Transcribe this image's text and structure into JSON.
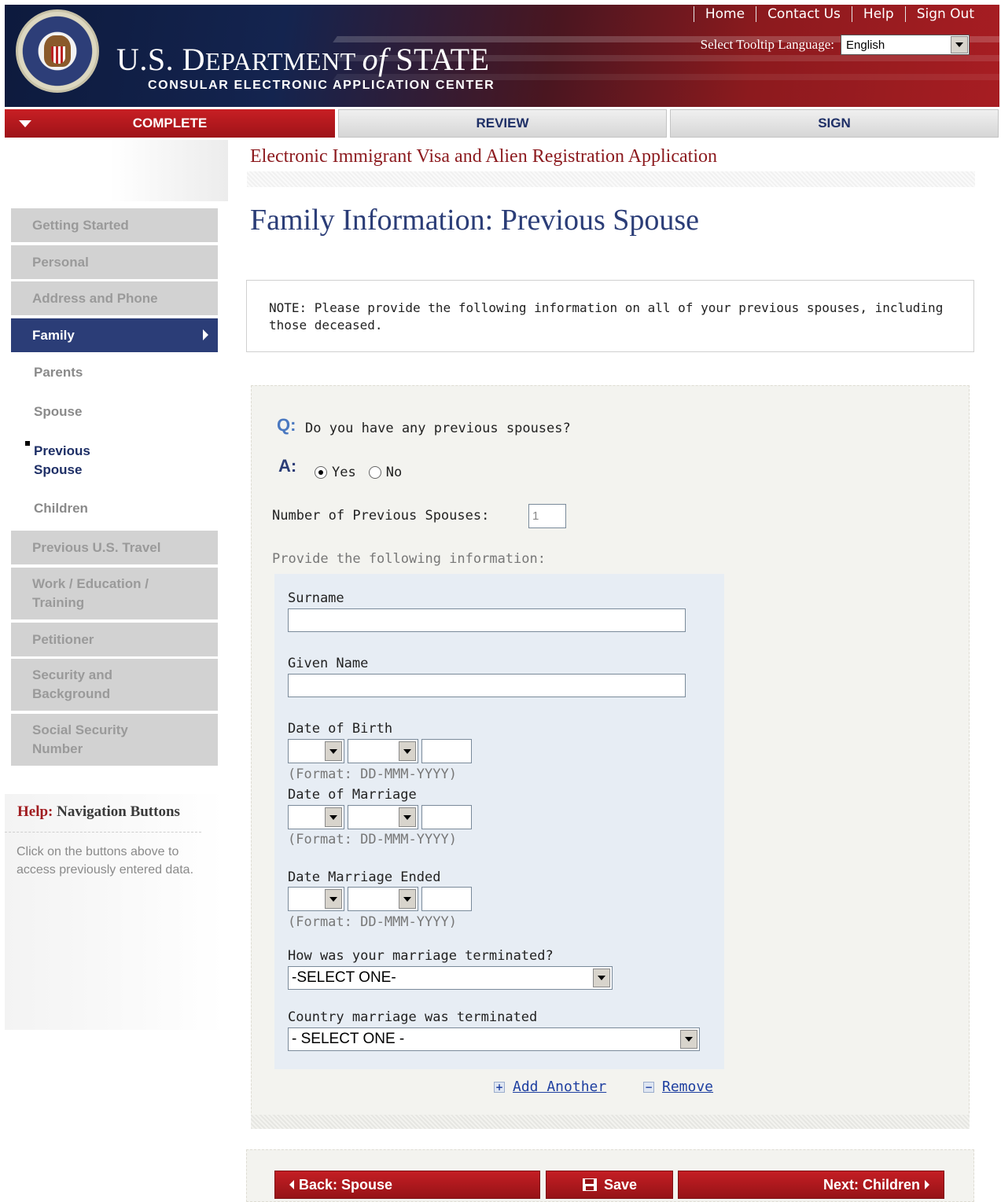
{
  "header": {
    "title_prefix": "U.S. D",
    "title_mid": "EPARTMENT ",
    "title_of": "of",
    "title_end": " STATE",
    "subtitle": "CONSULAR ELECTRONIC APPLICATION CENTER",
    "links": [
      "Home",
      "Contact Us",
      "Help",
      "Sign Out"
    ],
    "tooltip_label": "Select Tooltip Language:",
    "tooltip_language": "English"
  },
  "tabs": [
    "COMPLETE",
    "REVIEW",
    "SIGN"
  ],
  "sidebar": {
    "items": [
      "Getting Started",
      "Personal",
      "Address and Phone",
      "Family",
      "Previous U.S. Travel",
      "Work / Education / Training",
      "Petitioner",
      "Security and Background",
      "Social Security Number"
    ],
    "subitems": [
      "Parents",
      "Spouse",
      "Previous Spouse",
      "Children"
    ],
    "help_label": "Help:",
    "help_title": "Navigation Buttons",
    "help_text": "Click on the buttons above to access previously entered data."
  },
  "main": {
    "app_title": "Electronic Immigrant Visa and Alien Registration Application",
    "page_title": "Family Information: Previous Spouse",
    "note": "NOTE: Please provide the following information on all of your previous spouses, including those deceased.",
    "q_label": "Q:",
    "question": "Do you have any previous spouses?",
    "a_label": "A:",
    "answer_yes": "Yes",
    "answer_no": "No",
    "selected_answer": "Yes",
    "num_spouses_label": "Number of Previous Spouses:",
    "num_spouses_value": "1",
    "provide_label": "Provide the following information:",
    "surname_label": "Surname",
    "given_name_label": "Given Name",
    "dob_label": "Date of Birth",
    "dom_label": "Date of Marriage",
    "dme_label": "Date Marriage Ended",
    "date_format": "(Format: DD-MMM-YYYY)",
    "termination_label": "How was your marriage terminated?",
    "termination_value": "-SELECT ONE-",
    "country_label": "Country marriage was terminated",
    "country_value": "- SELECT ONE -",
    "add_another": "Add Another",
    "remove": "Remove"
  },
  "footer": {
    "back": "Back: Spouse",
    "save": "Save",
    "next": "Next: Children"
  },
  "colors": {
    "accent_red": "#a71d22",
    "nav_blue": "#2b3d77"
  }
}
